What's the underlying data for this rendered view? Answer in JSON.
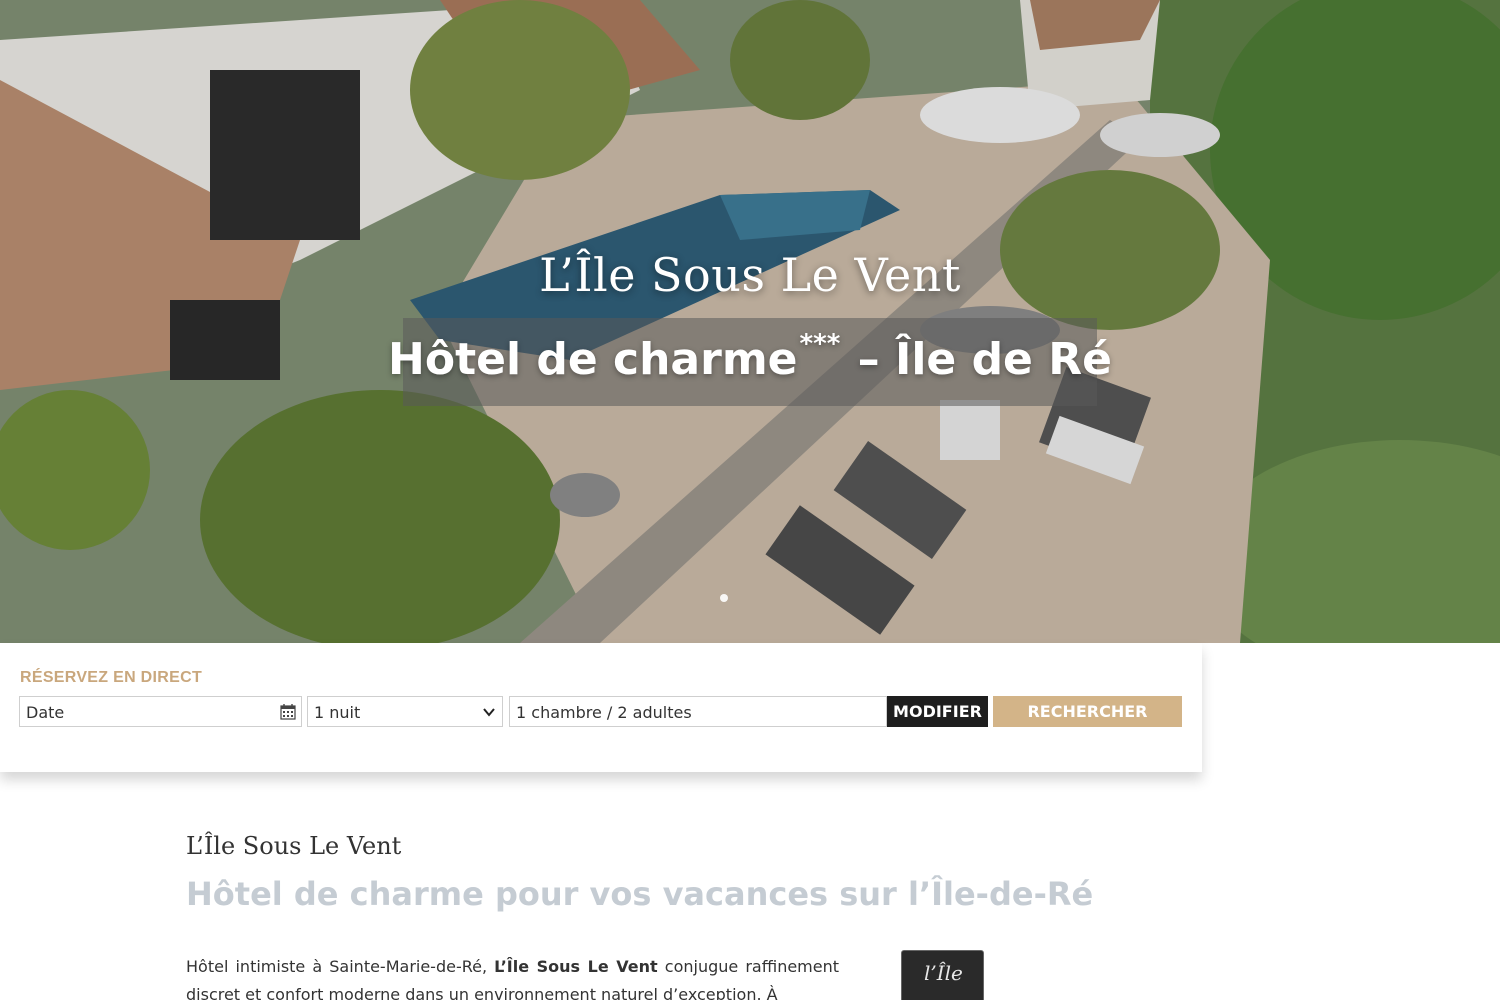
{
  "hero": {
    "title": "L’Île Sous Le Vent",
    "subtitle_main": "Hôtel de charme",
    "subtitle_stars": "***",
    "subtitle_rest": " – Île de Ré",
    "slider_position": 1
  },
  "booking": {
    "label": "RÉSERVEZ EN DIRECT",
    "date_placeholder": "Date",
    "nights_value": "1 nuit",
    "rooms_value": "1 chambre / 2 adultes",
    "modify_label": "MODIFIER",
    "search_label": "RECHERCHER"
  },
  "intro": {
    "name": "L’Île Sous Le Vent",
    "heading": "Hôtel de charme pour vos vacances sur l’Île-de-Ré",
    "text_before": "Hôtel intimiste à Sainte-Marie-de-Ré, ",
    "text_bold": "L’Île Sous Le Vent",
    "text_after": " conjugue raffinement discret et confort moderne dans un environnement naturel d’exception. À"
  },
  "colors": {
    "accent_gold": "#d3b488",
    "label_gold": "#c9a77d",
    "dark_button": "#1e1e1e",
    "heading_grey": "#c5ccd3"
  },
  "icons": {
    "calendar": "calendar-icon",
    "dropdown": "chevron-down-icon"
  }
}
